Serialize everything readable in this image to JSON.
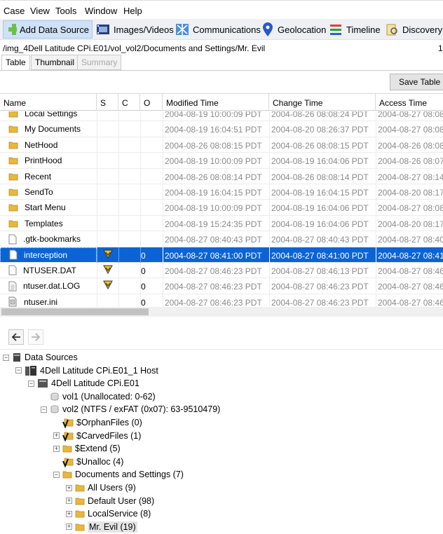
{
  "menu": [
    "Case",
    "View",
    "Tools",
    "Window",
    "Help"
  ],
  "toolbar": {
    "add_data_source": "Add Data Source",
    "images_videos": "Images/Videos",
    "communications": "Communications",
    "geolocation": "Geolocation",
    "timeline": "Timeline",
    "discovery": "Discovery"
  },
  "path": "/img_4Dell Latitude CPi.E01/vol_vol2/Documents and Settings/Mr. Evil",
  "path_right": "1",
  "tabs": {
    "table": "Table",
    "thumbnail": "Thumbnail",
    "summary": "Summary"
  },
  "save_table": "Save Table",
  "columns": [
    "Name",
    "S",
    "C",
    "O",
    "Modified Time",
    "Change Time",
    "Access Time"
  ],
  "rows": [
    {
      "name": "Local Settings",
      "s": "",
      "o": "",
      "m": "2004-08-19 10:00:09 PDT",
      "c": "2004-08-26 08:08:24 PDT",
      "a": "2004-08-27 08:08",
      "type": "folder"
    },
    {
      "name": "My Documents",
      "s": "",
      "o": "",
      "m": "2004-08-19 16:04:51 PDT",
      "c": "2004-08-20 08:26:37 PDT",
      "a": "2004-08-27 08:08",
      "type": "folder"
    },
    {
      "name": "NetHood",
      "s": "",
      "o": "",
      "m": "2004-08-26 08:08:15 PDT",
      "c": "2004-08-26 08:08:15 PDT",
      "a": "2004-08-26 08:08",
      "type": "folder"
    },
    {
      "name": "PrintHood",
      "s": "",
      "o": "",
      "m": "2004-08-19 10:00:09 PDT",
      "c": "2004-08-19 16:04:06 PDT",
      "a": "2004-08-26 08:07",
      "type": "folder"
    },
    {
      "name": "Recent",
      "s": "",
      "o": "",
      "m": "2004-08-26 08:08:14 PDT",
      "c": "2004-08-26 08:08:14 PDT",
      "a": "2004-08-27 08:14",
      "type": "folder"
    },
    {
      "name": "SendTo",
      "s": "",
      "o": "",
      "m": "2004-08-19 16:04:15 PDT",
      "c": "2004-08-19 16:04:15 PDT",
      "a": "2004-08-20 08:17",
      "type": "folder"
    },
    {
      "name": "Start Menu",
      "s": "",
      "o": "",
      "m": "2004-08-19 10:00:09 PDT",
      "c": "2004-08-19 16:04:06 PDT",
      "a": "2004-08-27 08:08",
      "type": "folder"
    },
    {
      "name": "Templates",
      "s": "",
      "o": "",
      "m": "2004-08-19 15:24:35 PDT",
      "c": "2004-08-19 16:04:06 PDT",
      "a": "2004-08-20 08:17",
      "type": "folder"
    },
    {
      "name": ".gtk-bookmarks",
      "s": "",
      "o": "",
      "m": "2004-08-27 08:40:43 PDT",
      "c": "2004-08-27 08:40:43 PDT",
      "a": "2004-08-27 08:40",
      "type": "file"
    },
    {
      "name": "interception",
      "s": "flag",
      "o": "0",
      "m": "2004-08-27 08:41:00 PDT",
      "c": "2004-08-27 08:41:00 PDT",
      "a": "2004-08-27 08:41",
      "type": "file",
      "selected": true
    },
    {
      "name": "NTUSER.DAT",
      "s": "flag",
      "o": "0",
      "m": "2004-08-27 08:46:23 PDT",
      "c": "2004-08-27 08:46:13 PDT",
      "a": "2004-08-27 08:46",
      "type": "file"
    },
    {
      "name": "ntuser.dat.LOG",
      "s": "flag",
      "o": "0",
      "m": "2004-08-27 08:46:23 PDT",
      "c": "2004-08-27 08:46:23 PDT",
      "a": "2004-08-27 08:46",
      "type": "textfile"
    },
    {
      "name": "ntuser.ini",
      "s": "",
      "o": "0",
      "m": "2004-08-27 08:46:23 PDT",
      "c": "2004-08-27 08:46:23 PDT",
      "a": "2004-08-27 08:46",
      "type": "inifile"
    }
  ],
  "tree": [
    {
      "label": "Data Sources",
      "toggle": "-",
      "icon": "datasource",
      "level": 0
    },
    {
      "label": "4Dell Latitude CPi.E01_1 Host",
      "toggle": "-",
      "icon": "host",
      "level": 1
    },
    {
      "label": "4Dell Latitude CPi.E01",
      "toggle": "-",
      "icon": "image",
      "level": 2
    },
    {
      "label": "vol1 (Unallocated: 0-62)",
      "toggle": "",
      "icon": "volume",
      "level": 3
    },
    {
      "label": "vol2 (NTFS / exFAT (0x07): 63-9510479)",
      "toggle": "-",
      "icon": "volume",
      "level": 3
    },
    {
      "label": "$OrphanFiles (0)",
      "toggle": "",
      "icon": "vfolder",
      "level": 4
    },
    {
      "label": "$CarvedFiles (1)",
      "toggle": "+",
      "icon": "vfolder",
      "level": 4
    },
    {
      "label": "$Extend (5)",
      "toggle": "+",
      "icon": "folder",
      "level": 4
    },
    {
      "label": "$Unalloc (4)",
      "toggle": "",
      "icon": "vfolder",
      "level": 4
    },
    {
      "label": "Documents and Settings (7)",
      "toggle": "-",
      "icon": "folder",
      "level": 4
    },
    {
      "label": "All Users (9)",
      "toggle": "+",
      "icon": "folder",
      "level": 5
    },
    {
      "label": "Default User (98)",
      "toggle": "+",
      "icon": "folder",
      "level": 5
    },
    {
      "label": "LocalService (8)",
      "toggle": "+",
      "icon": "folder",
      "level": 5
    },
    {
      "label": "Mr. Evil (19)",
      "toggle": "+",
      "icon": "folder",
      "level": 5,
      "selected": true
    }
  ]
}
